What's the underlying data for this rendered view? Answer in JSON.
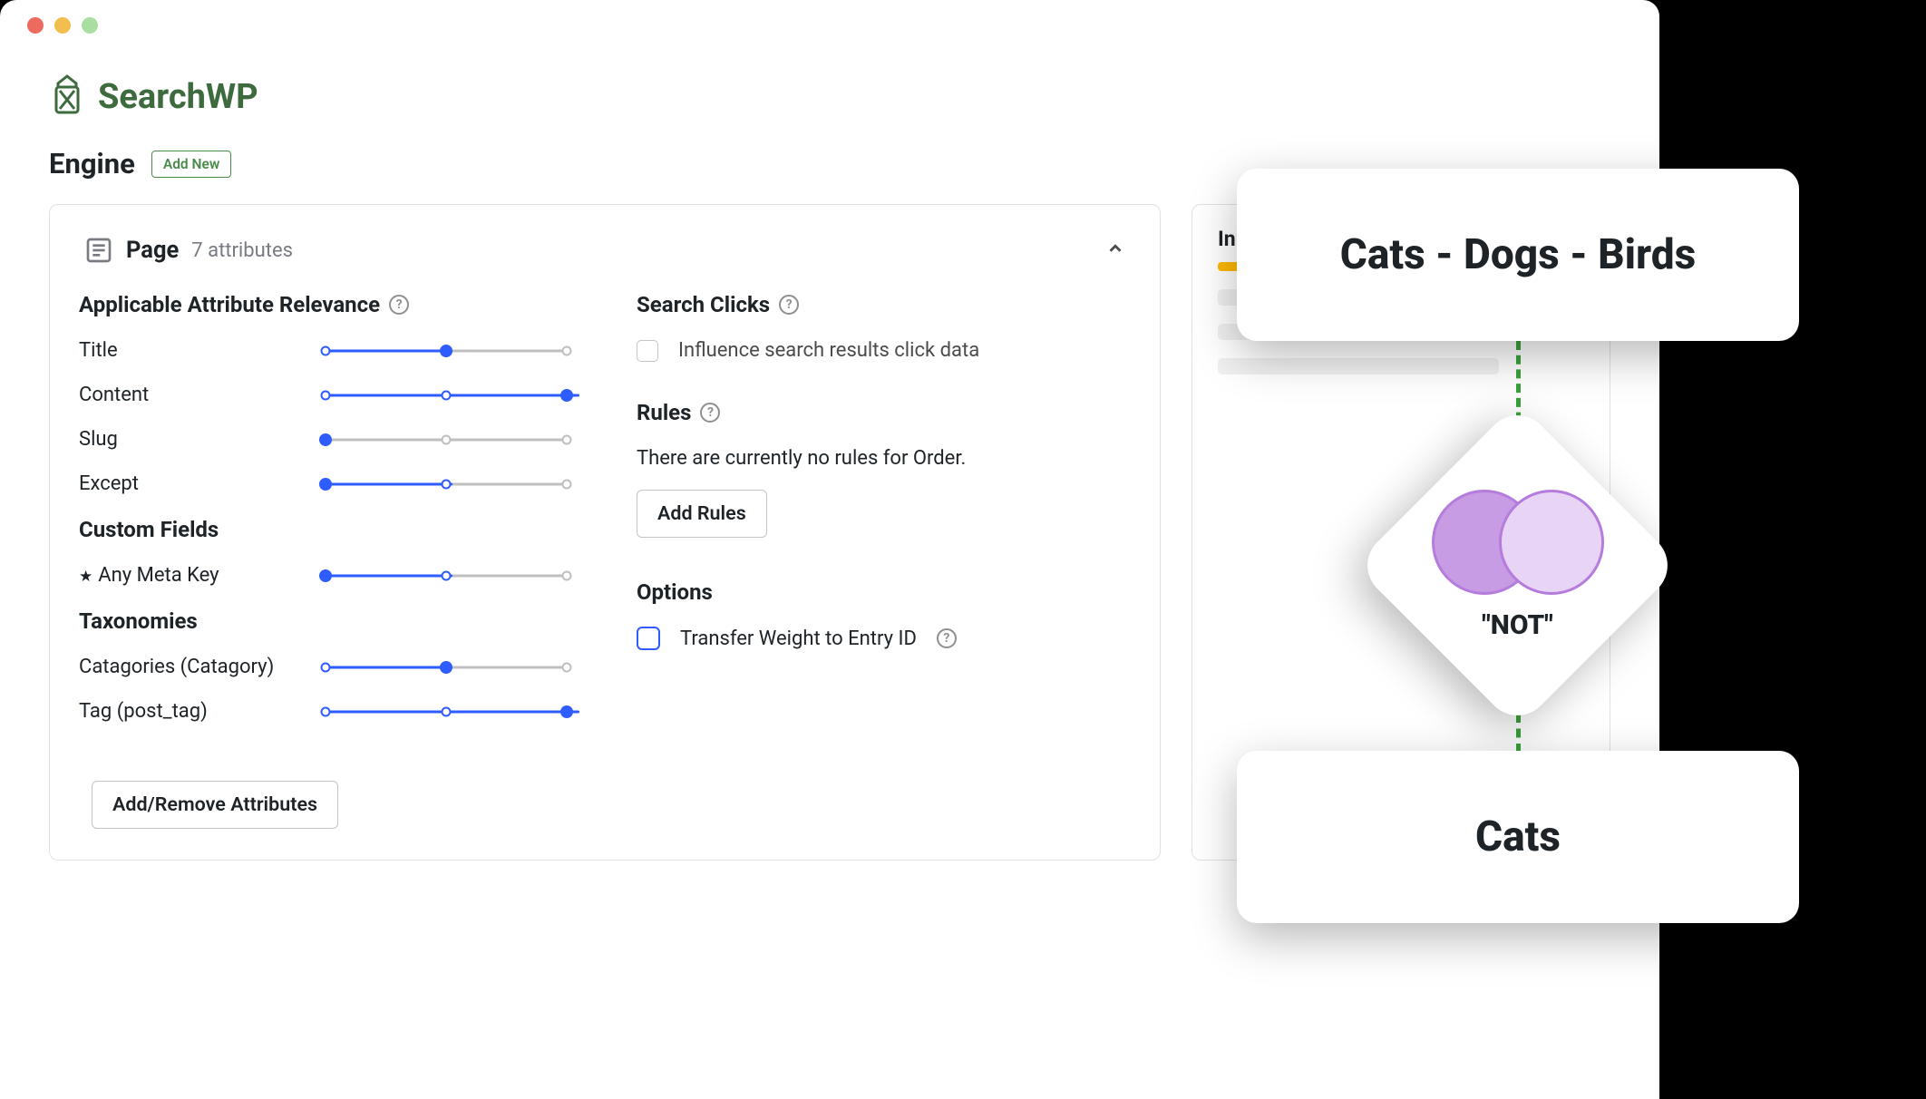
{
  "brand": "SearchWP",
  "engine": {
    "title": "Engine",
    "add_new": "Add New"
  },
  "panel": {
    "title": "Page",
    "subtitle": "7 attributes",
    "left": {
      "section1": "Applicable Attribute Relevance",
      "sliders": [
        {
          "label": "Title",
          "value": 50
        },
        {
          "label": "Content",
          "value": 100
        },
        {
          "label": "Slug",
          "value": 0
        },
        {
          "label": "Except",
          "value": 50
        }
      ],
      "section2": "Custom Fields",
      "cf": {
        "label": "Any Meta Key",
        "value": 50
      },
      "section3": "Taxonomies",
      "tax": [
        {
          "label": "Catagories (Catagory)",
          "value": 50
        },
        {
          "label": "Tag (post_tag)",
          "value": 100
        }
      ],
      "attr_button": "Add/Remove Attributes"
    },
    "right": {
      "section1": "Search Clicks",
      "influence": "Influence search results click data",
      "section2": "Rules",
      "rules_text": "There are currently no rules for Order.",
      "add_rules": "Add Rules",
      "section3": "Options",
      "transfer": "Transfer Weight to Entry ID"
    }
  },
  "side": {
    "label": "In"
  },
  "overlay": {
    "card1": "Cats - Dogs - Birds",
    "not": "\"NOT\"",
    "card3": "Cats"
  }
}
